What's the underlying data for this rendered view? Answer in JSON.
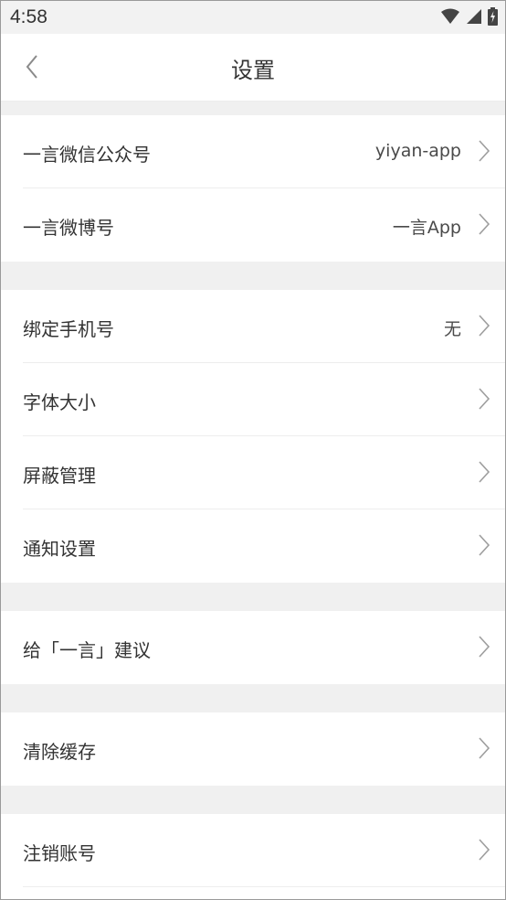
{
  "status_bar": {
    "time": "4:58",
    "icons": [
      "wifi-icon",
      "cell-signal-icon",
      "battery-charging-icon"
    ]
  },
  "header": {
    "title": "设置",
    "back_icon": "chevron-left-icon"
  },
  "groups": [
    {
      "items": [
        {
          "label": "一言微信公众号",
          "value": "yiyan-app"
        },
        {
          "label": "一言微博号",
          "value": "一言App"
        }
      ]
    },
    {
      "items": [
        {
          "label": "绑定手机号",
          "value": "无"
        },
        {
          "label": "字体大小",
          "value": ""
        },
        {
          "label": "屏蔽管理",
          "value": ""
        },
        {
          "label": "通知设置",
          "value": ""
        }
      ]
    },
    {
      "items": [
        {
          "label": "给「一言」建议",
          "value": ""
        }
      ]
    },
    {
      "items": [
        {
          "label": "清除缓存",
          "value": ""
        }
      ]
    },
    {
      "items": [
        {
          "label": "注销账号",
          "value": ""
        }
      ]
    }
  ],
  "colors": {
    "divider_band": "#f0f0f0",
    "text": "#333333",
    "chevron": "#9e9e9e"
  }
}
